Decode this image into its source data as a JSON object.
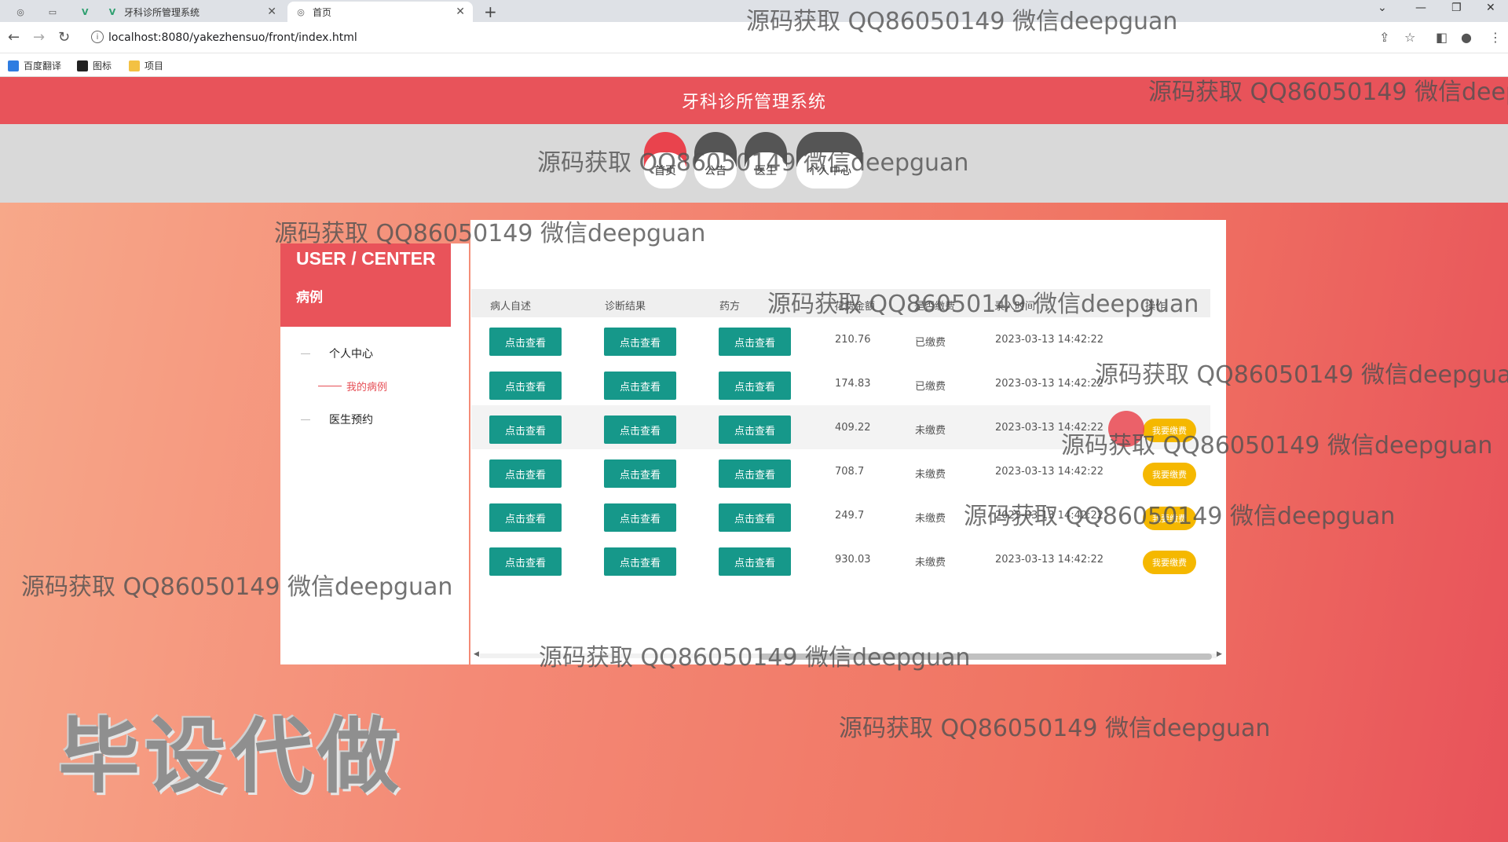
{
  "browser": {
    "tabs": [
      {
        "label": "",
        "icon": "page-icon"
      },
      {
        "label": "",
        "icon": "page-icon"
      },
      {
        "label": "牙科诊所管理系统",
        "icon": "vue-icon"
      },
      {
        "label": "首页",
        "icon": "globe-icon",
        "active": true
      }
    ],
    "url": "localhost:8080/yakezhensuo/front/index.html",
    "bookmarks": [
      {
        "label": "百度翻译",
        "color": "#2f7de1"
      },
      {
        "label": "图标",
        "color": "#222222"
      },
      {
        "label": "项目",
        "color": "#f3c143"
      }
    ]
  },
  "site": {
    "title": "牙科诊所管理系统",
    "nav": [
      {
        "label": "首页",
        "active": true
      },
      {
        "label": "公告"
      },
      {
        "label": "医生"
      },
      {
        "label": "个人中心"
      }
    ]
  },
  "sidebar": {
    "title": "USER / CENTER",
    "subtitle": "病例",
    "menu": [
      {
        "label": "个人中心"
      },
      {
        "label": "我的病例",
        "active": true
      },
      {
        "label": "医生预约"
      }
    ]
  },
  "table": {
    "headers": [
      "病人自述",
      "诊断结果",
      "药方",
      "花费金额",
      "是否缴费",
      "录入时间",
      "操作"
    ],
    "view_label": "点击查看",
    "pay_label": "我要缴费",
    "rows": [
      {
        "amount": "210.76",
        "status": "已缴费",
        "time": "2023-03-13 14:42:22",
        "can_pay": false
      },
      {
        "amount": "174.83",
        "status": "已缴费",
        "time": "2023-03-13 14:42:22",
        "can_pay": false
      },
      {
        "amount": "409.22",
        "status": "未缴费",
        "time": "2023-03-13 14:42:22",
        "can_pay": true
      },
      {
        "amount": "708.7",
        "status": "未缴费",
        "time": "2023-03-13 14:42:22",
        "can_pay": true
      },
      {
        "amount": "249.7",
        "status": "未缴费",
        "time": "2023-03-13 14:42:22",
        "can_pay": true
      },
      {
        "amount": "930.03",
        "status": "未缴费",
        "time": "2023-03-13 14:42:22",
        "can_pay": true
      }
    ]
  },
  "watermark": "源码获取 QQ86050149 微信deepguan",
  "stamp": "毕设代做",
  "colors": {
    "brand": "#e8535a",
    "view_button": "#16988a",
    "pay_button": "#f5b800"
  }
}
